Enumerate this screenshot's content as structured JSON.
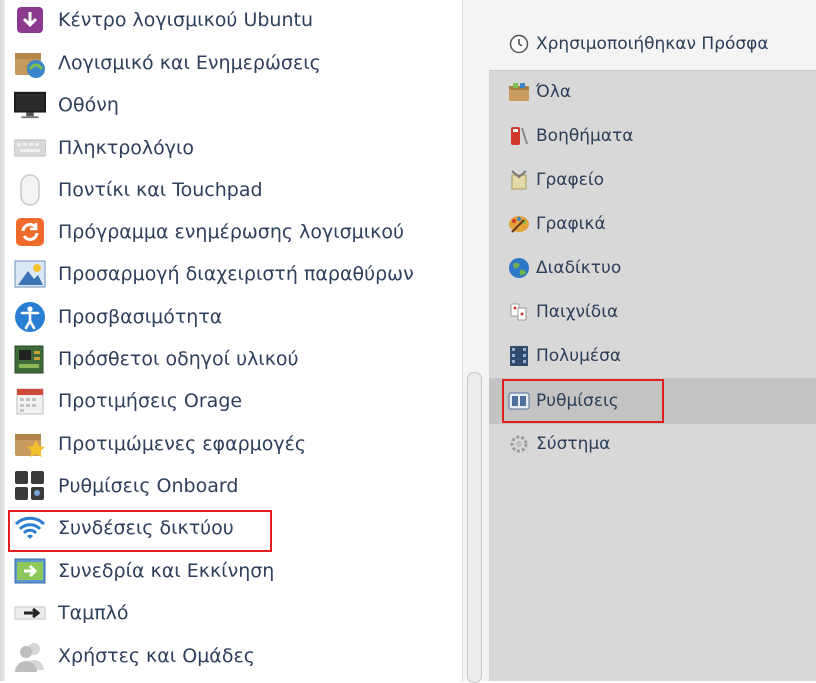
{
  "left_list": {
    "items": [
      {
        "label": "Κέντρο λογισμικού Ubuntu",
        "icon": "software-center-icon"
      },
      {
        "label": "Λογισμικό και Ενημερώσεις",
        "icon": "software-updates-icon"
      },
      {
        "label": "Οθόνη",
        "icon": "monitor-icon"
      },
      {
        "label": "Πληκτρολόγιο",
        "icon": "keyboard-icon"
      },
      {
        "label": "Ποντίκι και Touchpad",
        "icon": "mouse-icon"
      },
      {
        "label": "Πρόγραμμα ενημέρωσης λογισμικού",
        "icon": "update-manager-icon"
      },
      {
        "label": "Προσαρμογή διαχειριστή παραθύρων",
        "icon": "window-manager-icon"
      },
      {
        "label": "Προσβασιμότητα",
        "icon": "accessibility-icon"
      },
      {
        "label": "Πρόσθετοι οδηγοί υλικού",
        "icon": "hardware-drivers-icon"
      },
      {
        "label": "Προτιμήσεις Orage",
        "icon": "calendar-icon"
      },
      {
        "label": "Προτιμώμενες εφαρμογές",
        "icon": "preferred-apps-icon"
      },
      {
        "label": "Ρυθμίσεις Onboard",
        "icon": "onboard-keyboard-icon"
      },
      {
        "label": "Συνδέσεις δικτύου",
        "icon": "wifi-icon",
        "highlighted": true
      },
      {
        "label": "Συνεδρία και Εκκίνηση",
        "icon": "session-startup-icon"
      },
      {
        "label": "Ταμπλό",
        "icon": "panel-icon"
      },
      {
        "label": "Χρήστες και Ομάδες",
        "icon": "users-icon"
      }
    ]
  },
  "categories": {
    "recent": {
      "label": "Χρησιμοποιήθηκαν Πρόσφα",
      "icon": "clock-icon"
    },
    "items": [
      {
        "label": "Όλα",
        "icon": "all-apps-icon"
      },
      {
        "label": "Βοηθήματα",
        "icon": "accessories-icon"
      },
      {
        "label": "Γραφείο",
        "icon": "office-icon"
      },
      {
        "label": "Γραφικά",
        "icon": "graphics-icon"
      },
      {
        "label": "Διαδίκτυο",
        "icon": "internet-globe-icon"
      },
      {
        "label": "Παιχνίδια",
        "icon": "games-icon"
      },
      {
        "label": "Πολυμέσα",
        "icon": "multimedia-icon"
      },
      {
        "label": "Ρυθμίσεις",
        "icon": "settings-icon",
        "selected": true,
        "highlighted": true
      },
      {
        "label": "Σύστημα",
        "icon": "system-gear-icon"
      }
    ]
  },
  "colors": {
    "highlight_border": "#e02020",
    "selected_background": "#c3c3c3",
    "category_pane_background": "#d8d8d8",
    "text": "#2e3f5c"
  }
}
